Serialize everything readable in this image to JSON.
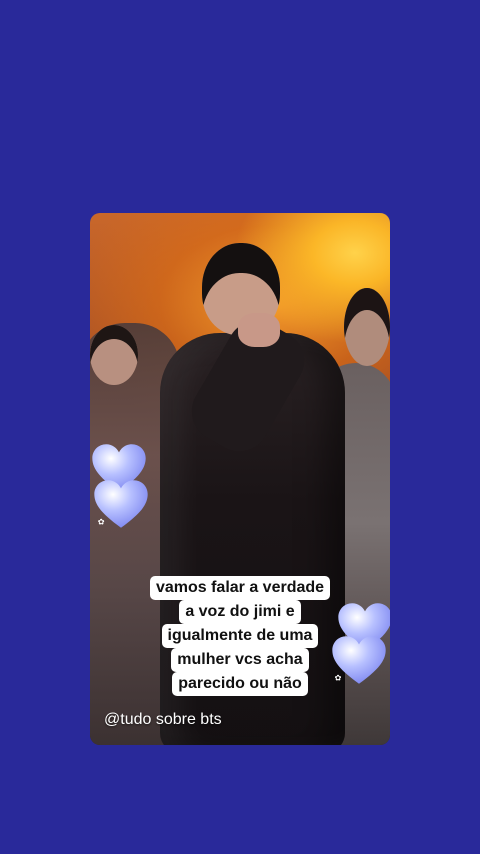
{
  "background_color": "#29299a",
  "story": {
    "caption_lines": [
      "vamos falar a verdade",
      "a voz do jimi e",
      "igualmente de uma",
      "mulher vcs acha",
      "parecido ou não"
    ],
    "handle": "@tudo sobre bts",
    "heart_color": "#a9b4ff",
    "sticker": "heart-sticker-icon"
  }
}
